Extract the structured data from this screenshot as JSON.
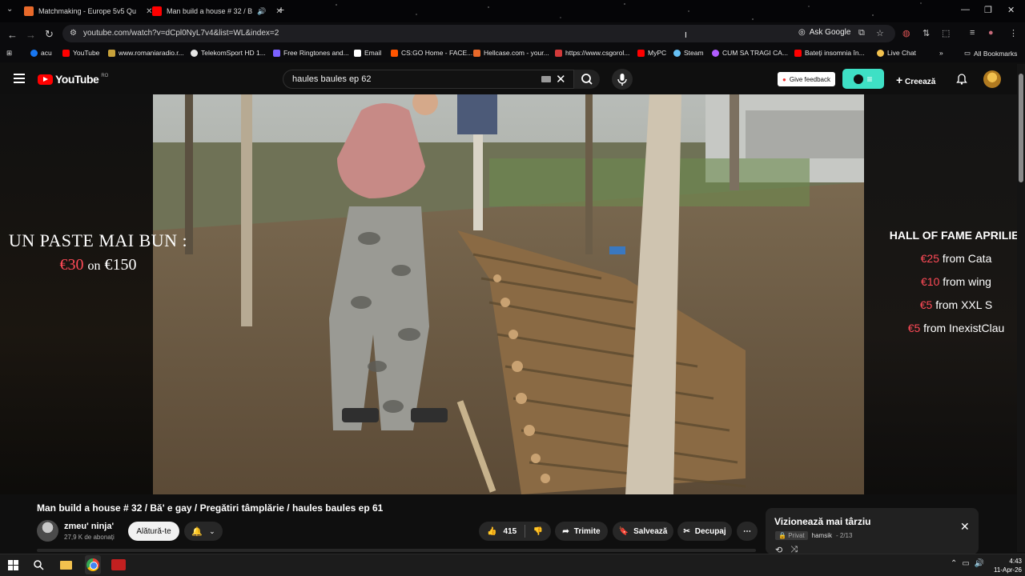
{
  "browser": {
    "tabs": [
      {
        "title": "Matchmaking - Europe 5v5 Qu",
        "favicon_color": "#e8692a"
      },
      {
        "title": "Man build a house # 32 / B",
        "favicon_color": "#ff0000",
        "active": true
      }
    ],
    "url": "youtube.com/watch?v=dCpl0NyL7v4&list=WL&index=2",
    "ask_google": "Ask Google",
    "bookmarks": [
      {
        "label": "acu",
        "color": "#1877f2"
      },
      {
        "label": "YouTube",
        "color": "#ff0000"
      },
      {
        "label": "www.romaniaradio.r...",
        "color": "#c7a13a"
      },
      {
        "label": "TelekomSport HD 1...",
        "color": "#e6e6e6"
      },
      {
        "label": "Free Ringtones and...",
        "color": "#7b61ff"
      },
      {
        "label": "Email",
        "color": "#ffffff"
      },
      {
        "label": "CS:GO Home - FACE...",
        "color": "#ff5500"
      },
      {
        "label": "Hellcase.com - your...",
        "color": "#e8692a"
      },
      {
        "label": "https://www.csgorol...",
        "color": "#d23a3a"
      },
      {
        "label": "MyPC",
        "color": "#ff0000"
      },
      {
        "label": "Steam",
        "color": "#66c0f4"
      },
      {
        "label": "CUM SA TRAGI CA...",
        "color": "#b05cff"
      },
      {
        "label": "Bateți insomnia în...",
        "color": "#ff0000"
      },
      {
        "label": "Live Chat",
        "color": "#f2c14e"
      },
      {
        "label": "All Bookmarks",
        "color": "#cccccc"
      }
    ]
  },
  "youtube": {
    "logo": "YouTube",
    "region": "RO",
    "search_query": "haules baules ep 62",
    "give_feedback": "Give feedback",
    "create_label": "Creează",
    "create_prefix": "+",
    "video_title": "Man build a house # 32 / Bă' e gay / Pregătiri tâmplărie / haules baules ep 61",
    "channel": {
      "name": "zmeu' ninja'",
      "subscribers": "27,9 K de abonați",
      "join_label": "Alătură-te"
    },
    "actions": {
      "likes": "415",
      "share": "Trimite",
      "save": "Salvează",
      "clip": "Decupaj"
    },
    "overlay_left": {
      "title": "UN PASTE MAI BUN :",
      "current": "€30",
      "connector": "on",
      "goal": "€150"
    },
    "overlay_right": {
      "title": "HALL OF FAME APRILIE:",
      "entries": [
        {
          "amount": "€25",
          "from": "from Cata"
        },
        {
          "amount": "€10",
          "from": "from wing"
        },
        {
          "amount": "€5",
          "from": "from XXL S"
        },
        {
          "amount": "€5",
          "from": "from InexistClau"
        }
      ]
    },
    "watch_later_popup": {
      "title": "Vizionează mai târziu",
      "privacy": "Privat",
      "owner": "hamsik",
      "position": "- 2/13"
    }
  },
  "taskbar": {
    "time": "4:43",
    "date": "11-Apr-26"
  },
  "colors": {
    "accent_red": "#ff0000",
    "donation_red": "#ff4a57",
    "teal": "#3ee0c5"
  }
}
